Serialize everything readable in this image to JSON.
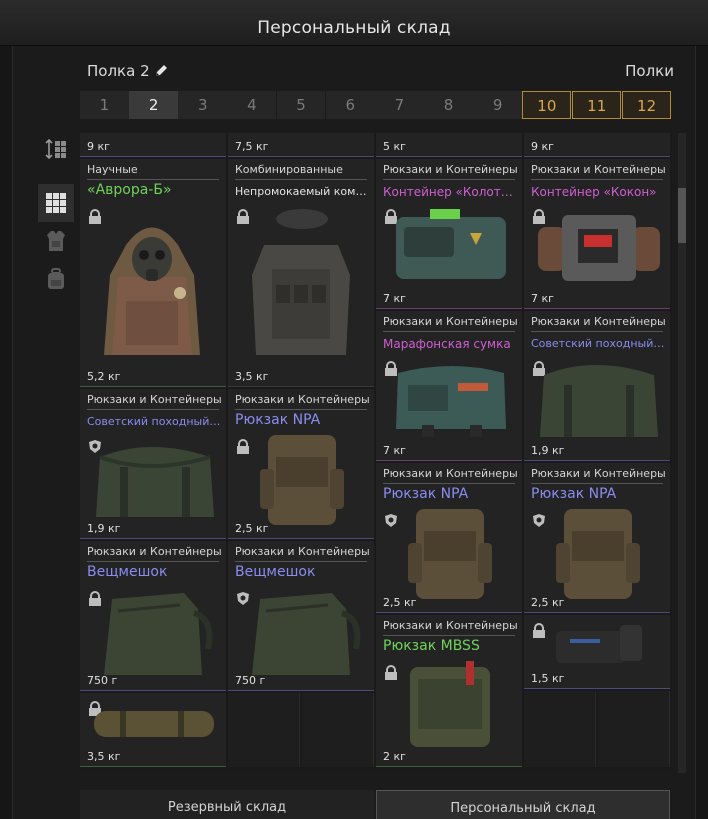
{
  "title": "Персональный склад",
  "shelf": {
    "name": "Полка 2",
    "shelves_label": "Полки"
  },
  "tabs": [
    "1",
    "2",
    "3",
    "4",
    "5",
    "6",
    "7",
    "8",
    "9",
    "10",
    "11",
    "12"
  ],
  "active_tab": "2",
  "columns": [
    {
      "cells": [
        {
          "weight": "9 кг"
        },
        {
          "category": "Научные",
          "name": "«Аврора-Б»",
          "weight": "5,2 кг"
        },
        {
          "category": "Рюкзаки и Контейнеры",
          "name": "Советский походный рю...",
          "weight": "1,9 кг"
        },
        {
          "category": "Рюкзаки и Контейнеры",
          "name": "Вещмешок",
          "weight": "750 г"
        },
        {
          "weight": "3,5 кг"
        }
      ]
    },
    {
      "cells": [
        {
          "weight": "7,5 кг"
        },
        {
          "category": "Комбинированные",
          "name": "Непромокаемый комбе...",
          "weight": "3,5 кг"
        },
        {
          "category": "Рюкзаки и Контейнеры",
          "name": "Рюкзак NPA",
          "weight": "2,5 кг"
        },
        {
          "category": "Рюкзаки и Контейнеры",
          "name": "Вещмешок",
          "weight": "750 г"
        }
      ]
    },
    {
      "cells": [
        {
          "weight": "5 кг"
        },
        {
          "category": "Рюкзаки и Контейнеры",
          "name": "Контейнер «Колотун»",
          "weight": "7 кг"
        },
        {
          "category": "Рюкзаки и Контейнеры",
          "name": "Марафонская сумка",
          "weight": "7 кг"
        },
        {
          "category": "Рюкзаки и Контейнеры",
          "name": "Рюкзак NPA",
          "weight": "2,5 кг"
        },
        {
          "category": "Рюкзаки и Контейнеры",
          "name": "Рюкзак MBSS",
          "weight": "2 кг"
        }
      ]
    },
    {
      "cells": [
        {
          "weight": "9 кг"
        },
        {
          "category": "Рюкзаки и Контейнеры",
          "name": "Контейнер «Кокон»",
          "weight": "7 кг"
        },
        {
          "category": "Рюкзаки и Контейнеры",
          "name": "Советский походный рю...",
          "weight": "1,9 кг"
        },
        {
          "category": "Рюкзаки и Контейнеры",
          "name": "Рюкзак NPA",
          "weight": "2,5 кг"
        },
        {
          "weight": "1,5 кг"
        }
      ]
    }
  ],
  "rarity_colors": {
    "green": "#6fd35c",
    "blue": "#8a8cf0",
    "pink": "#cf5fd2",
    "gold": "#d9a948"
  },
  "sidebar_icons": [
    "sort-icon",
    "grid-view-icon",
    "armor-filter-icon",
    "backpack-filter-icon"
  ],
  "bottom_tabs": {
    "reserve": "Резервный склад",
    "personal": "Персональный склад"
  }
}
